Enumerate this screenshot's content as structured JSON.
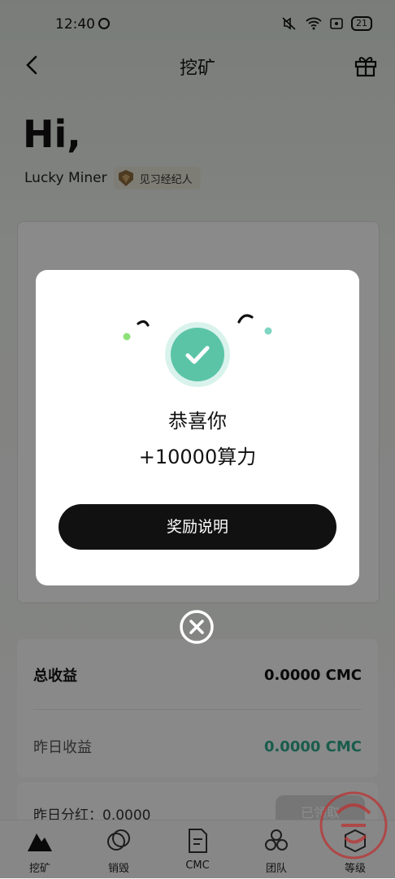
{
  "status_bar": {
    "time": "12:40",
    "battery": "21"
  },
  "header": {
    "title": "挖矿"
  },
  "greeting": "Hi,",
  "user": {
    "name": "Lucky Miner",
    "level_badge": "见习经纪人"
  },
  "earnings": {
    "total_label": "总收益",
    "total_value": "0.0000 CMC",
    "yesterday_label": "昨日收益",
    "yesterday_value": "0.0000 CMC"
  },
  "dividend": {
    "label": "昨日分红：0.0000",
    "button": "已领取"
  },
  "tabs": [
    {
      "label": "挖矿",
      "icon": "mountain-icon"
    },
    {
      "label": "销毁",
      "icon": "circles-icon"
    },
    {
      "label": "CMC",
      "icon": "document-icon"
    },
    {
      "label": "团队",
      "icon": "hexagons-icon"
    },
    {
      "label": "等级",
      "icon": "level-icon"
    }
  ],
  "modal": {
    "title": "恭喜你",
    "reward": "+10000算力",
    "button": "奖励说明"
  },
  "colors": {
    "accent": "#5bc4a7",
    "value_green": "#2fa889",
    "button_dark": "#111111"
  }
}
